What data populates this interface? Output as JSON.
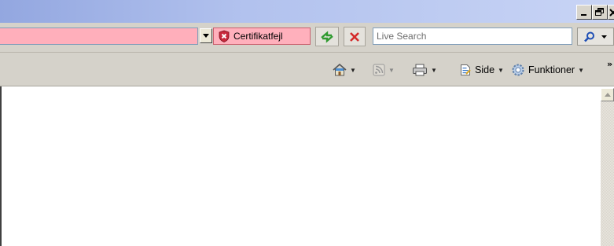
{
  "titlebar": {
    "min_glyph": "_",
    "max_glyph": "🗗",
    "close_glyph": "✕"
  },
  "navbar": {
    "address_value": "",
    "cert_error_label": "Certifikatfejl",
    "search_placeholder": "Live Search",
    "address_bg_color": "#ffafbb"
  },
  "commandbar": {
    "items": [
      {
        "name": "home",
        "label": ""
      },
      {
        "name": "feeds",
        "label": ""
      },
      {
        "name": "print",
        "label": ""
      },
      {
        "name": "side",
        "label": "Side"
      },
      {
        "name": "funktioner",
        "label": "Funktioner"
      }
    ],
    "overflow_glyph": "»"
  }
}
